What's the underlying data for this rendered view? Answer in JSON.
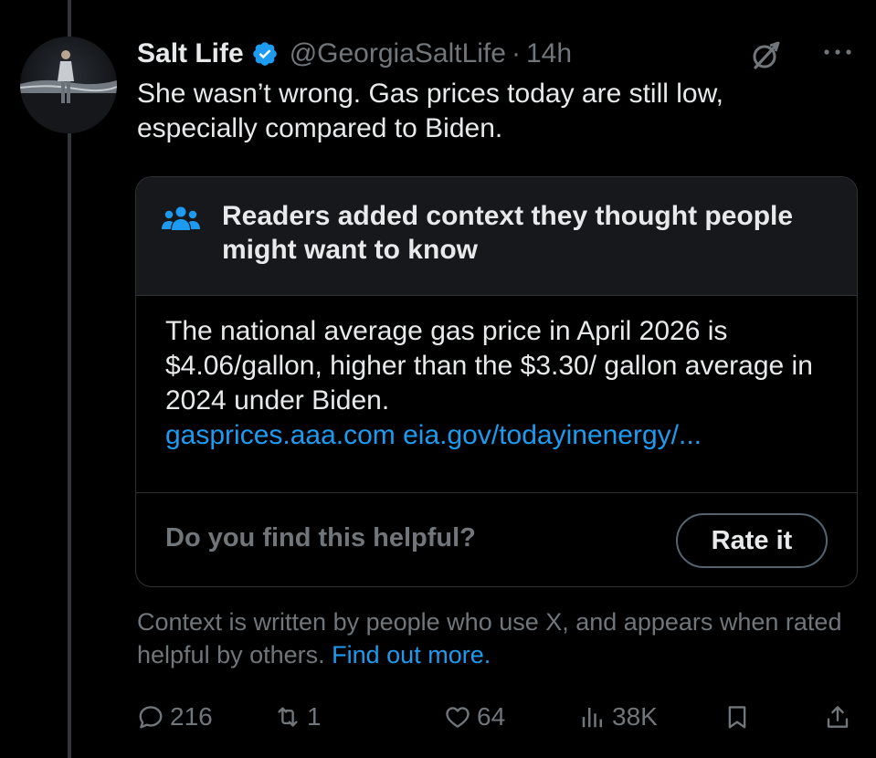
{
  "post": {
    "author": {
      "display_name": "Salt Life",
      "handle": "@GeorgiaSaltLife",
      "verified": true,
      "avatar_icon": "avatar-photo"
    },
    "separator": "·",
    "time": "14h",
    "text": "She wasn’t wrong. Gas prices today are still low, especially compared to Biden.",
    "header_icons": [
      "grok-icon",
      "more-icon"
    ]
  },
  "community_note": {
    "heading": "Readers added context they thought people might want to know",
    "body": "The national average gas price in April 2026 is $4.06/gallon, higher than the $3.30/ gallon average in 2024 under Biden.",
    "links": "gasprices.aaa.com eia.gov/todayinenergy/...",
    "helpful_question": "Do you find this helpful?",
    "rate_button": "Rate it"
  },
  "context_footer": {
    "text": "Context is written by people who use X, and appears when rated helpful by others.",
    "link": "Find out more."
  },
  "actions": {
    "replies": "216",
    "reposts": "1",
    "likes": "64",
    "views": "38K"
  },
  "colors": {
    "background": "#000000",
    "text": "#e7e9ea",
    "muted": "#71767b",
    "link": "#1d9bf0",
    "card_header": "#16181c",
    "border": "#2f3336"
  }
}
